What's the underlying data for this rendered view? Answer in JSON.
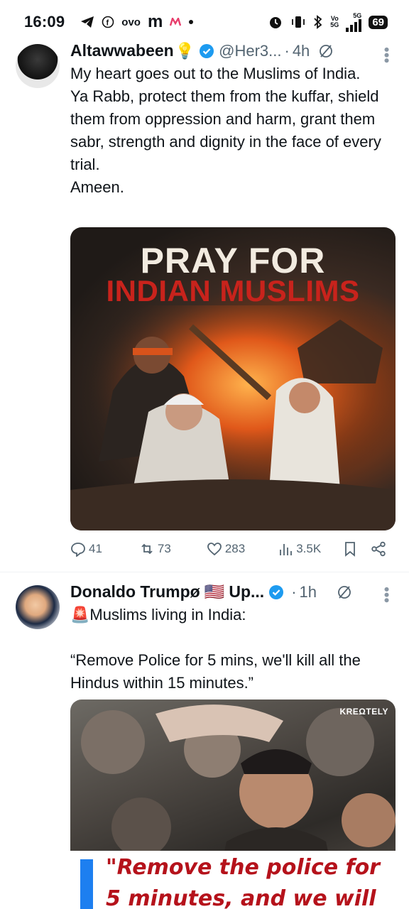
{
  "status_bar": {
    "time": "16:09",
    "left_icons": [
      "telegram-icon",
      "facebook-icon",
      "ovo-label",
      "m-icon",
      "myntra-icon",
      "dot-icon"
    ],
    "ovo": "ovo",
    "m_label": "m",
    "right_icons": [
      "alarm-icon",
      "vibrate-icon",
      "bluetooth-icon",
      "volte-icon",
      "5g-signal-icon"
    ],
    "volte_top": "Vo",
    "volte_bottom": "5G",
    "net": "5G",
    "battery": "69"
  },
  "tweets": [
    {
      "name": "Altawwabeen",
      "name_emoji": "💡",
      "handle": "@Her3...",
      "separator": "·",
      "time": "4h",
      "text_lines": [
        "My heart goes out to the Muslims of India.",
        "Ya Rabb, protect them from the kuffar, shield them from oppression and harm, grant them sabr, strength and dignity in the face of every trial.",
        "Ameen."
      ],
      "media": {
        "title_line1": "PRAY FOR",
        "title_line2": "INDIAN MUSLIMS"
      },
      "actions": {
        "replies": "41",
        "reposts": "73",
        "likes": "283",
        "views": "3.5K"
      }
    },
    {
      "name": "Donaldo Trumpø",
      "name_flag": "🇺🇸",
      "name_tail": "Up...",
      "separator": "·",
      "time": "1h",
      "siren": "🚨",
      "text_lines": [
        "Muslims living in India:",
        "“Remove Police for 5 mins, we'll kill all the Hindus within 15 minutes.”"
      ],
      "media": {
        "watermark": "KREΩTELY",
        "caption_line1": "\"Remove the police for",
        "caption_line2": "5 minutes, and we will"
      }
    }
  ],
  "colors": {
    "verified": "#1d9bf0",
    "muted": "#536471",
    "text": "#0f1419",
    "poster_red": "#c8231c",
    "caption_red": "#b5121b"
  }
}
